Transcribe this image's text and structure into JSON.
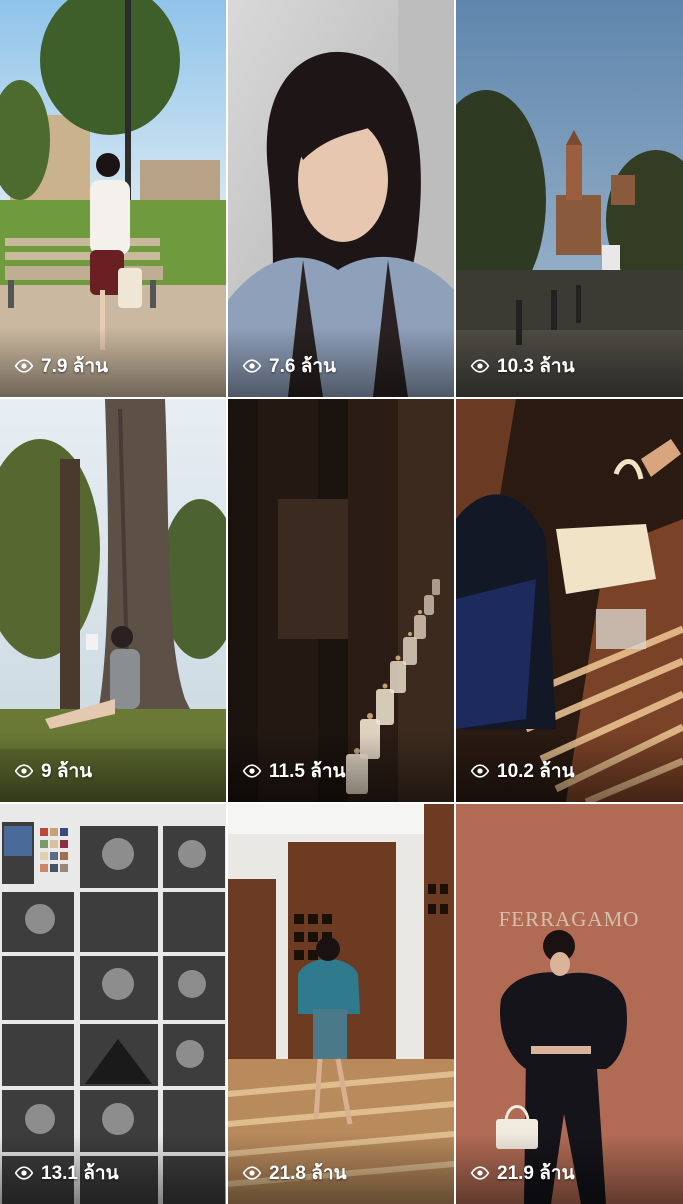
{
  "grid": {
    "tiles": [
      {
        "id": "tile-1",
        "views": "7.9 ล้าน",
        "scene": "park-bench"
      },
      {
        "id": "tile-2",
        "views": "7.6 ล้าน",
        "scene": "portrait"
      },
      {
        "id": "tile-3",
        "views": "10.3 ล้าน",
        "scene": "castle-tower"
      },
      {
        "id": "tile-4",
        "views": "9 ล้าน",
        "scene": "tree-reading"
      },
      {
        "id": "tile-5",
        "views": "11.5 ล้าน",
        "scene": "candles"
      },
      {
        "id": "tile-6",
        "views": "10.2 ล้าน",
        "scene": "handbag-shadow"
      },
      {
        "id": "tile-7",
        "views": "13.1 ล้าน",
        "scene": "mood-board"
      },
      {
        "id": "tile-8",
        "views": "21.8 ล้าน",
        "scene": "runway"
      },
      {
        "id": "tile-9",
        "views": "21.9 ล้าน",
        "scene": "ferragamo-wall",
        "wall_text": "FERRAGAMO"
      }
    ]
  },
  "icons": {
    "views": "eye-icon"
  }
}
